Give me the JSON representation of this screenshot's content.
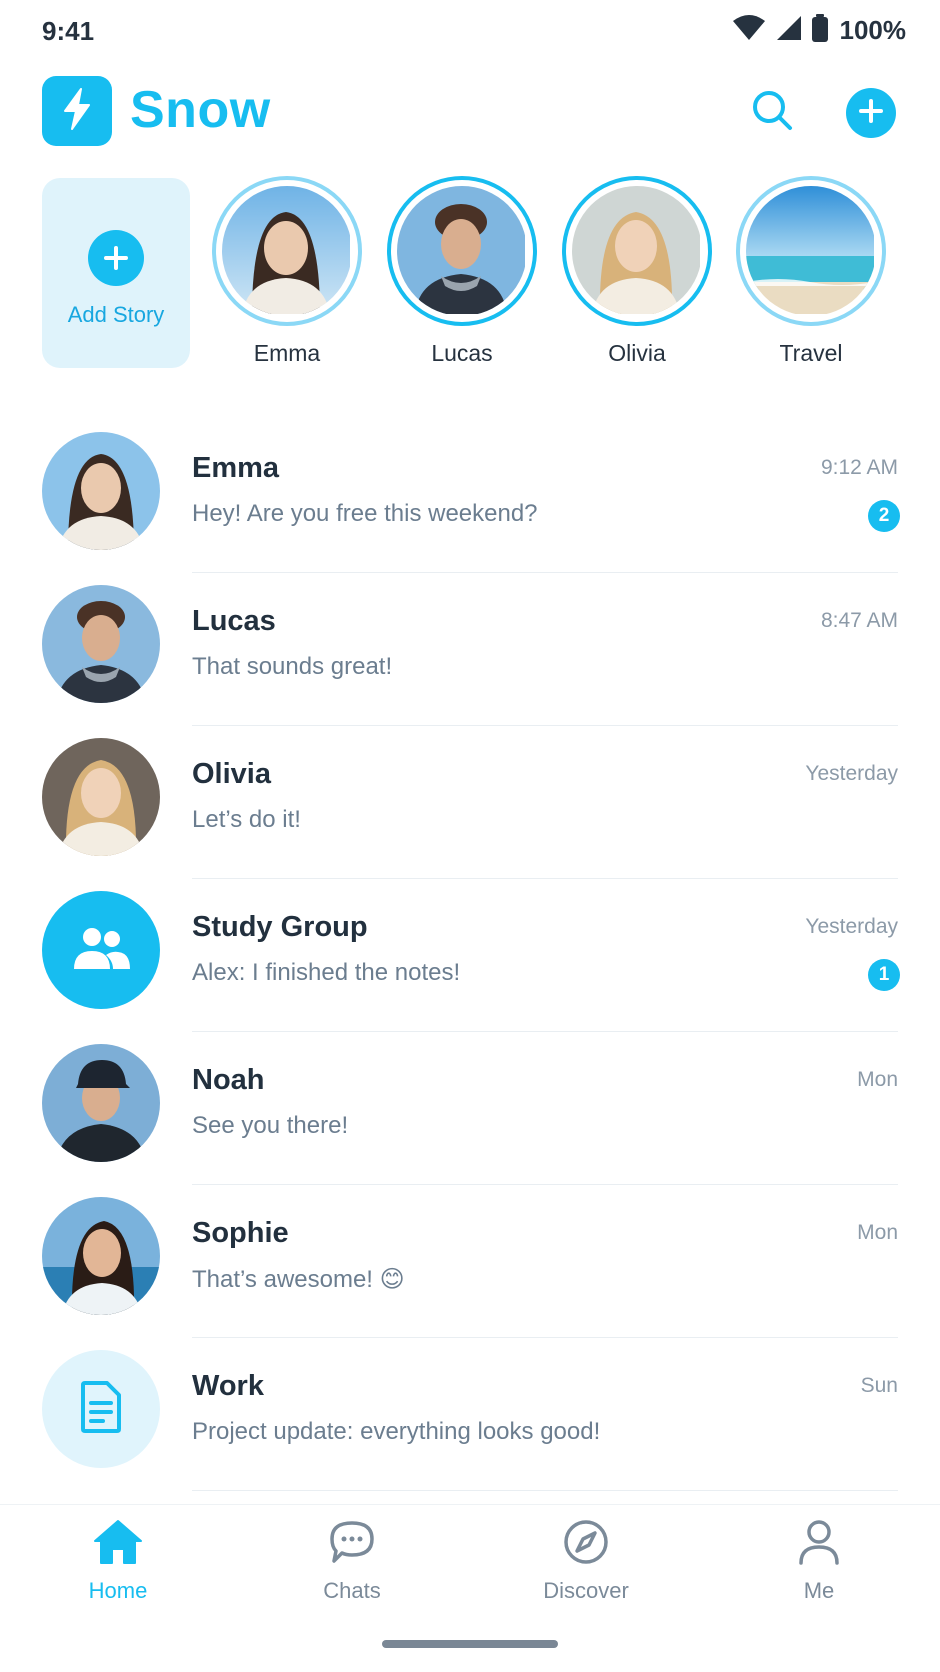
{
  "status_bar": {
    "time": "9:41",
    "battery": "100%"
  },
  "header": {
    "app_name": "Snow"
  },
  "stories": {
    "add_label": "Add Story",
    "items": [
      {
        "name": "Emma",
        "seen": true
      },
      {
        "name": "Lucas",
        "seen": false
      },
      {
        "name": "Olivia",
        "seen": false
      },
      {
        "name": "Travel",
        "seen": true
      }
    ]
  },
  "chats": [
    {
      "name": "Emma",
      "message": "Hey! Are you free this weekend?",
      "time": "9:12 AM",
      "badge": "2"
    },
    {
      "name": "Lucas",
      "message": "That sounds great!",
      "time": "8:47 AM"
    },
    {
      "name": "Olivia",
      "message": "Let’s do it!",
      "time": "Yesterday"
    },
    {
      "name": "Study Group",
      "message": "Alex: I finished the notes!",
      "time": "Yesterday",
      "badge": "1"
    },
    {
      "name": "Noah",
      "message": "See you there!",
      "time": "Mon"
    },
    {
      "name": "Sophie",
      "message": "That’s awesome! 😊",
      "time": "Mon"
    },
    {
      "name": "Work",
      "message": "Project update: everything looks good!",
      "time": "Sun"
    }
  ],
  "nav": {
    "home": "Home",
    "chats": "Chats",
    "discover": "Discover",
    "me": "Me"
  },
  "colors": {
    "accent": "#17bdf0",
    "text": "#22303e",
    "muted": "#6b7d8f"
  },
  "icons": [
    "wifi-icon",
    "signal-icon",
    "battery-icon",
    "bolt-icon",
    "search-icon",
    "plus-icon",
    "group-icon",
    "document-icon",
    "home-icon",
    "chat-bubble-icon",
    "compass-icon",
    "person-icon"
  ]
}
